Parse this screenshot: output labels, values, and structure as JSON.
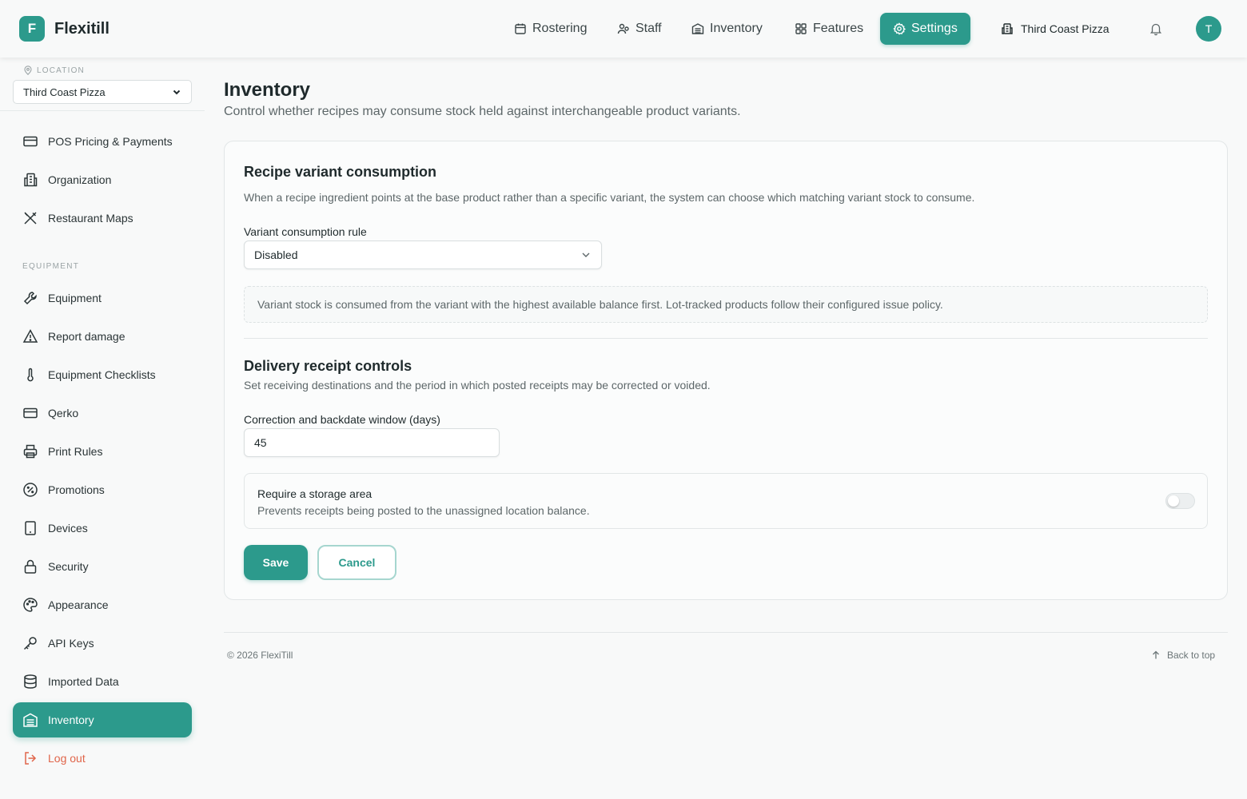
{
  "app": {
    "logo_letter": "F",
    "name": "Flexitill"
  },
  "nav": {
    "items": [
      {
        "label": "Rostering",
        "icon": "calendar-icon"
      },
      {
        "label": "Staff",
        "icon": "users-icon"
      },
      {
        "label": "Inventory",
        "icon": "warehouse-icon"
      },
      {
        "label": "Features",
        "icon": "grid-icon"
      },
      {
        "label": "Settings",
        "icon": "gear-icon",
        "active": true
      }
    ],
    "location": "Third Coast Pizza",
    "avatar_initial": "T"
  },
  "sidebar": {
    "location_label": "LOCATION",
    "location_value": "Third Coast Pizza",
    "section_equipment": "EQUIPMENT",
    "items": [
      {
        "label": "POS Pricing & Payments",
        "icon": "credit-card-icon"
      },
      {
        "label": "Organization",
        "icon": "building-icon"
      },
      {
        "label": "Restaurant Maps",
        "icon": "utensils-crossed-icon"
      },
      {
        "label": "Equipment",
        "icon": "wrench-icon"
      },
      {
        "label": "Report damage",
        "icon": "warning-icon"
      },
      {
        "label": "Equipment Checklists",
        "icon": "thermometer-icon"
      },
      {
        "label": "Qerko",
        "icon": "card-icon"
      },
      {
        "label": "Print Rules",
        "icon": "printer-icon"
      },
      {
        "label": "Promotions",
        "icon": "percent-badge-icon"
      },
      {
        "label": "Devices",
        "icon": "tablet-icon"
      },
      {
        "label": "Security",
        "icon": "lock-icon"
      },
      {
        "label": "Appearance",
        "icon": "palette-icon"
      },
      {
        "label": "API Keys",
        "icon": "key-icon"
      },
      {
        "label": "Imported Data",
        "icon": "database-icon"
      },
      {
        "label": "Inventory",
        "icon": "warehouse-icon",
        "active": true
      }
    ],
    "logout": "Log out"
  },
  "main": {
    "title": "Inventory",
    "subtitle": "Control whether recipes may consume stock held against interchangeable product variants.",
    "recipe": {
      "heading": "Recipe variant consumption",
      "description": "When a recipe ingredient points at the base product rather than a specific variant, the system can choose which matching variant stock to consume.",
      "rule_label": "Variant consumption rule",
      "rule_value": "Disabled",
      "info": "Variant stock is consumed from the variant with the highest available balance first. Lot-tracked products follow their configured issue policy."
    },
    "delivery": {
      "heading": "Delivery receipt controls",
      "description": "Set receiving destinations and the period in which posted receipts may be corrected or voided.",
      "window_label": "Correction and backdate window (days)",
      "window_value": "45",
      "storage_title": "Require a storage area",
      "storage_desc": "Prevents receipts being posted to the unassigned location balance.",
      "storage_enabled": false
    },
    "save_label": "Save",
    "cancel_label": "Cancel"
  },
  "footer": {
    "copyright": "© 2026 FlexiTill",
    "back_to_top": "Back to top"
  },
  "colors": {
    "accent": "#2c9a8c",
    "logout": "#e0654a"
  }
}
